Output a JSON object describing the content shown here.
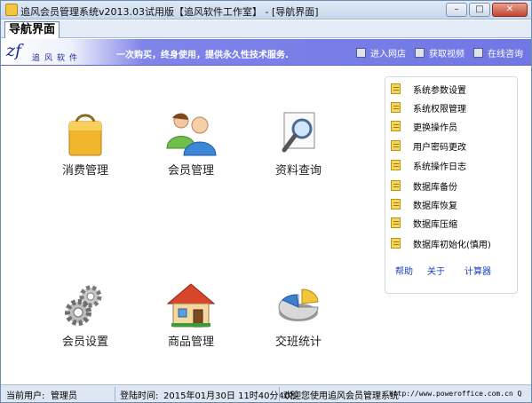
{
  "window": {
    "title": "追风会员管理系统v2013.03试用版【追风软件工作室】 - [导航界面]",
    "controls": {
      "minimize": "–",
      "maximize": "□",
      "close": "✕"
    }
  },
  "tab": {
    "label": "导航界面"
  },
  "banner": {
    "logo_mark": "zf",
    "logo_text": "追风软件",
    "slogan": "一次购买，终身使用，提供永久性技术服务.",
    "links": [
      "进入网店",
      "获取视频",
      "在线咨询"
    ]
  },
  "tiles": [
    {
      "label": "消费管理",
      "icon": "shopping-bag-icon"
    },
    {
      "label": "会员管理",
      "icon": "users-icon"
    },
    {
      "label": "资料查询",
      "icon": "magnifier-icon"
    },
    {
      "label": "会员设置",
      "icon": "gears-icon"
    },
    {
      "label": "商品管理",
      "icon": "house-icon"
    },
    {
      "label": "交班统计",
      "icon": "pie-chart-icon"
    }
  ],
  "panel": {
    "items": [
      "系统参数设置",
      "系统权限管理",
      "更换操作员",
      "用户密码更改",
      "系统操作日志",
      "数据库备份",
      "数据库恢复",
      "数据库压缩",
      "数据库初始化(慎用)"
    ],
    "links": [
      "帮助",
      "关于",
      "计算器"
    ]
  },
  "status": {
    "user_label": "当前用户:",
    "user_value": "管理员",
    "login_label": "登陆时间:",
    "login_value": "2015年01月30日  11时40分40秒",
    "welcome": "欢迎您使用追风会员管理系统",
    "url": "http://www.poweroffice.com.cn Q"
  },
  "colors": {
    "banner": "#7077e4",
    "link": "#1c3fbf",
    "window_border": "#6d8ab1"
  }
}
